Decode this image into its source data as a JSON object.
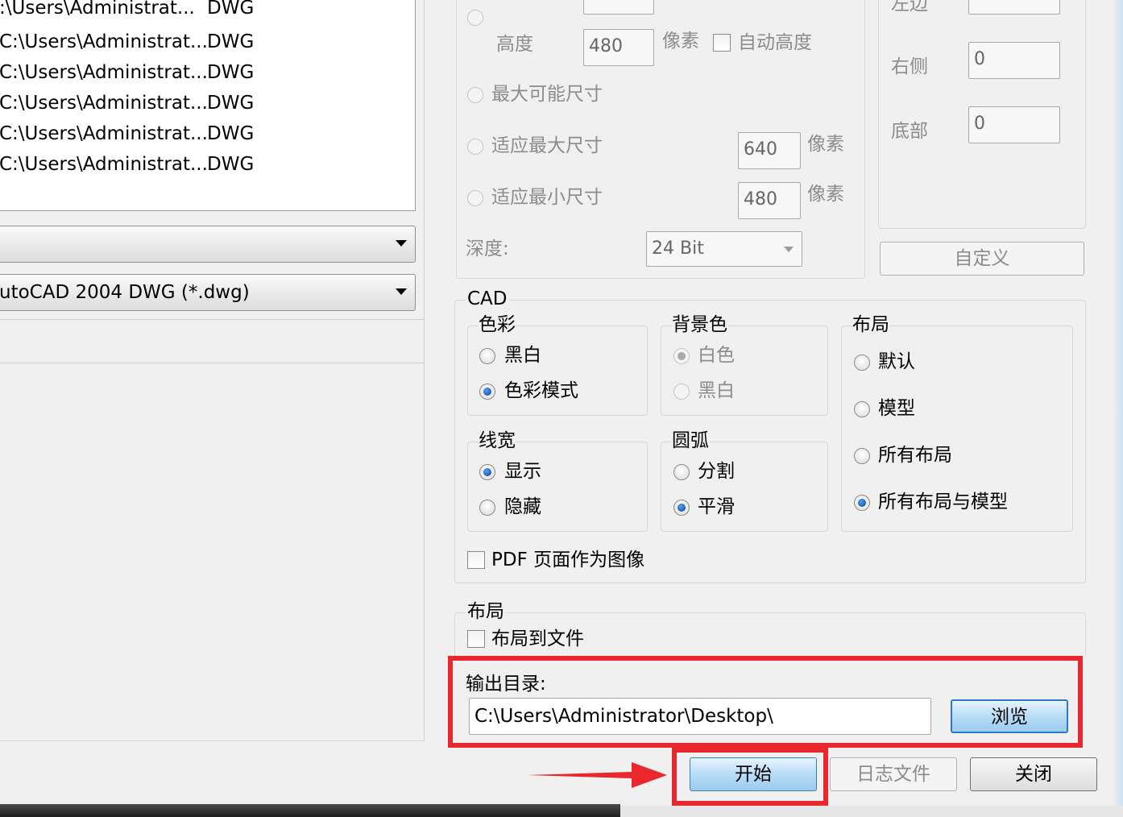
{
  "file_list": [
    {
      "path": ":\\Users\\Administrat...",
      "type": "DWG"
    },
    {
      "path": "C:\\Users\\Administrat...",
      "type": "DWG"
    },
    {
      "path": "C:\\Users\\Administrat...",
      "type": "DWG"
    },
    {
      "path": "C:\\Users\\Administrat...",
      "type": "DWG"
    },
    {
      "path": "C:\\Users\\Administrat...",
      "type": "DWG"
    },
    {
      "path": "C:\\Users\\Administrat...",
      "type": "DWG"
    }
  ],
  "combo_top": {
    "value": ""
  },
  "combo_format": {
    "value": "utoCAD 2004 DWG (*.dwg)"
  },
  "size": {
    "height_label": "高度",
    "height_value": "480",
    "pixel_unit": "像素",
    "auto_height": "自动高度",
    "max_size": "最大可能尺寸",
    "fit_max": "适应最大尺寸",
    "fit_max_value": "640",
    "fit_min": "适应最小尺寸",
    "fit_min_value": "480",
    "depth_label": "深度:",
    "depth_value": "24 Bit"
  },
  "margins": {
    "left_label": "左边",
    "right_label": "右侧",
    "right_value": "0",
    "bottom_label": "底部",
    "bottom_value": "0",
    "custom_button": "自定义"
  },
  "cad": {
    "title": "CAD",
    "color_group": {
      "title": "色彩",
      "options": [
        "黑白",
        "色彩模式"
      ]
    },
    "bg_group": {
      "title": "背景色",
      "options": [
        "白色",
        "黑白"
      ]
    },
    "layout_group": {
      "title": "布局",
      "options": [
        "默认",
        "模型",
        "所有布局",
        "所有布局与模型"
      ]
    },
    "lineweight_group": {
      "title": "线宽",
      "options": [
        "显示",
        "隐藏"
      ]
    },
    "arc_group": {
      "title": "圆弧",
      "options": [
        "分割",
        "平滑"
      ]
    },
    "pdf_as_image": "PDF 页面作为图像"
  },
  "layout": {
    "title": "布局",
    "layout_to_file": "布局到文件"
  },
  "output": {
    "label": "输出目录:",
    "path": "C:\\Users\\Administrator\\Desktop\\",
    "browse": "浏览"
  },
  "buttons": {
    "start": "开始",
    "log": "日志文件",
    "close": "关闭"
  },
  "colors": {
    "highlight": "#e8282d",
    "accent_blue": "#3c7fb1"
  }
}
